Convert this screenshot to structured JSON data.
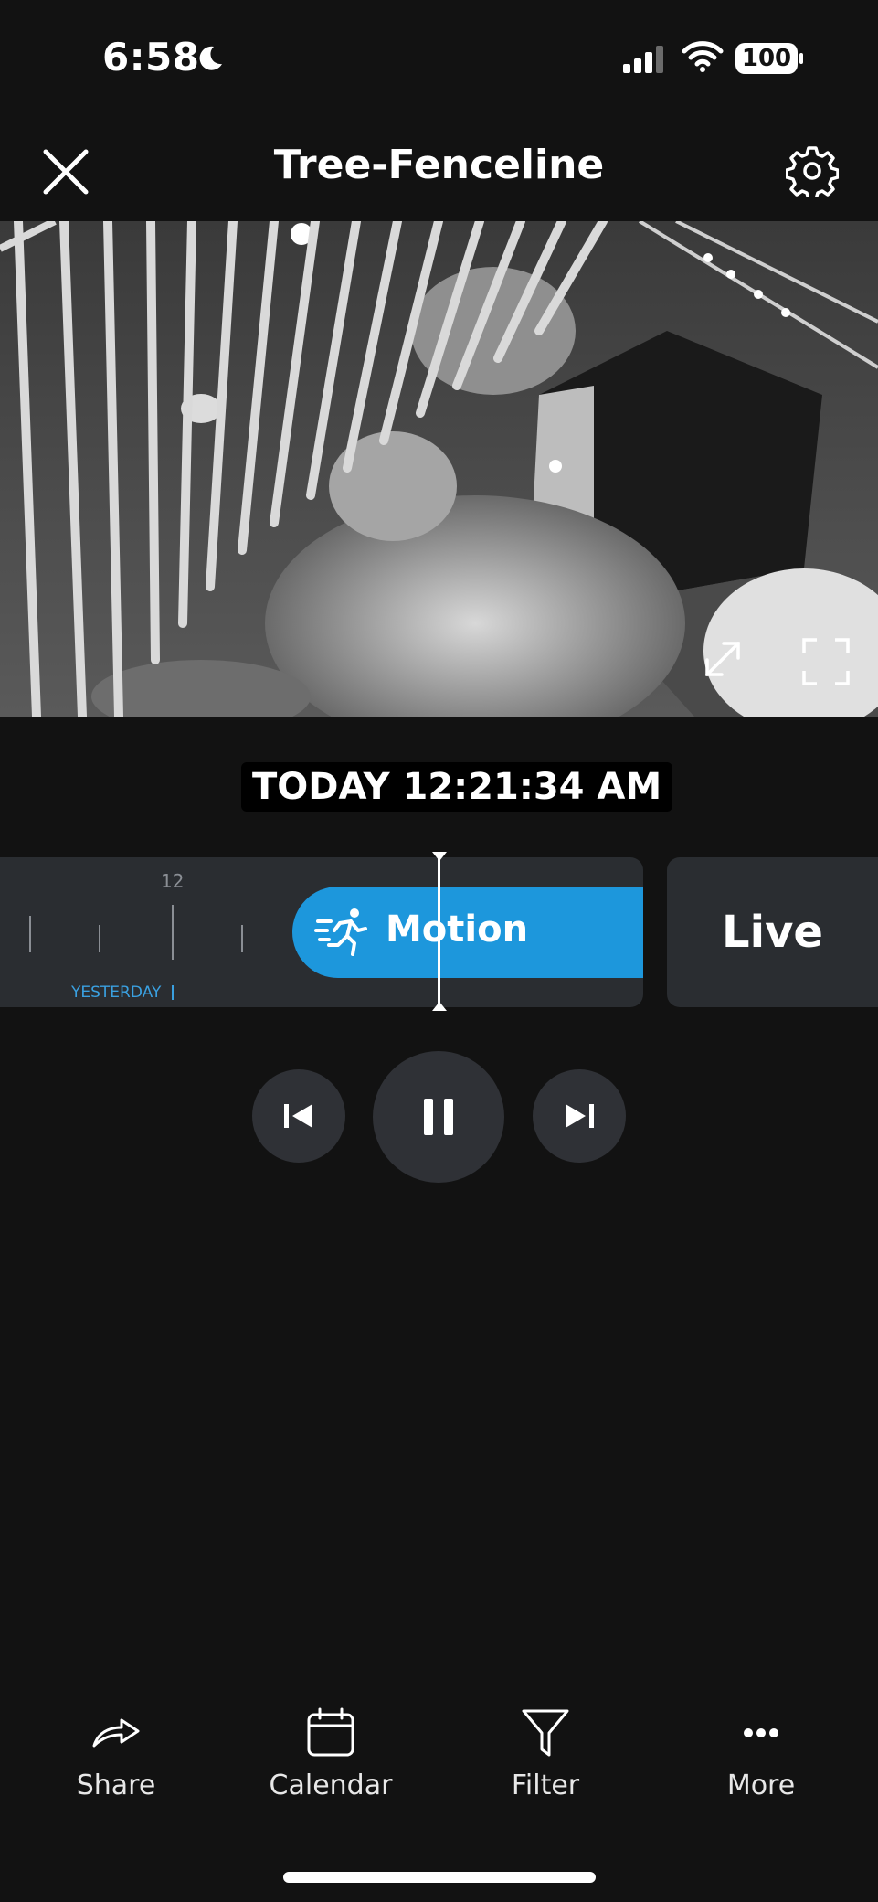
{
  "status_bar": {
    "time": "6:58",
    "battery": "100",
    "icons": [
      "moon-icon",
      "signal-icon",
      "wifi-icon",
      "battery-icon"
    ]
  },
  "header": {
    "title": "Tree-Fenceline",
    "close_icon": "close-icon",
    "settings_icon": "gear-icon"
  },
  "video": {
    "description_icons": [
      "expand-icon",
      "fullscreen-icon"
    ]
  },
  "playback": {
    "timestamp": "TODAY 12:21:34 AM"
  },
  "timeline": {
    "tick_label": "12",
    "day_label": "YESTERDAY",
    "event_label": "Motion",
    "live_label": "Live",
    "colors": {
      "event": "#1d97dc",
      "day_label": "#3aa0e0"
    }
  },
  "controls": {
    "icons": [
      "skip-previous-icon",
      "pause-icon",
      "skip-next-icon"
    ]
  },
  "bottom_nav": {
    "items": [
      {
        "label": "Share",
        "icon": "share-icon"
      },
      {
        "label": "Calendar",
        "icon": "calendar-icon"
      },
      {
        "label": "Filter",
        "icon": "filter-icon"
      },
      {
        "label": "More",
        "icon": "more-icon"
      }
    ]
  }
}
